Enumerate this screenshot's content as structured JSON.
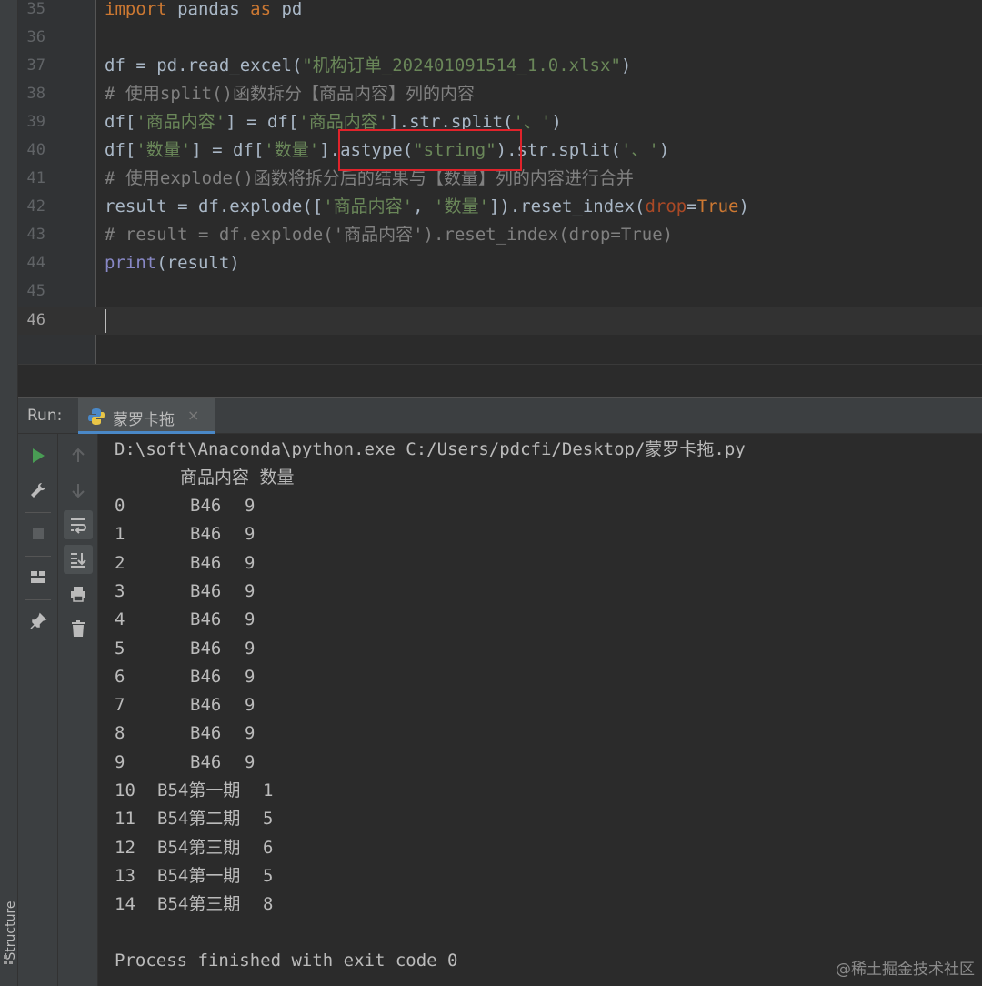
{
  "editor": {
    "lines": [
      {
        "num": "35"
      },
      {
        "num": "36"
      },
      {
        "num": "37"
      },
      {
        "num": "38"
      },
      {
        "num": "39"
      },
      {
        "num": "40"
      },
      {
        "num": "41"
      },
      {
        "num": "42"
      },
      {
        "num": "43"
      },
      {
        "num": "44"
      },
      {
        "num": "45"
      },
      {
        "num": "46"
      }
    ],
    "code": {
      "l35_kw1": "import",
      "l35_mod": " pandas ",
      "l35_kw2": "as",
      "l35_alias": " pd",
      "l37_a": "df = pd.read_excel(",
      "l37_str": "\"机构订单_202401091514_1.0.xlsx\"",
      "l37_b": ")",
      "l38_cmt": "# 使用split()函数拆分【商品内容】列的内容",
      "l39_a": "df[",
      "l39_s1": "'商品内容'",
      "l39_b": "] = df[",
      "l39_s2": "'商品内容'",
      "l39_c": "].str.split(",
      "l39_s3": "'、'",
      "l39_d": ")",
      "l40_a": "df[",
      "l40_s1": "'数量'",
      "l40_b": "] = df[",
      "l40_s2": "'数量'",
      "l40_c": "].astype(",
      "l40_s3": "\"string\"",
      "l40_d": ").str.split(",
      "l40_s4": "'、'",
      "l40_e": ")",
      "l41_cmt": "# 使用explode()函数将拆分后的结果与【数量】列的内容进行合并",
      "l42_a": "result = df.explode([",
      "l42_s1": "'商品内容'",
      "l42_b": ", ",
      "l42_s2": "'数量'",
      "l42_c": "]).reset_index(",
      "l42_param": "drop",
      "l42_d": "=",
      "l42_kw": "True",
      "l42_e": ")",
      "l43_cmt": "# result = df.explode('商品内容').reset_index(drop=True)",
      "l44_bi": "print",
      "l44_rest": "(result)"
    }
  },
  "run": {
    "label": "Run:",
    "tab_name": "蒙罗卡拖",
    "tab_close": "×",
    "command": "D:\\soft\\Anaconda\\python.exe C:/Users/pdcfi/Desktop/蒙罗卡拖.py",
    "header": "商品内容 数量",
    "rows": [
      {
        "idx": "0",
        "item": "B46",
        "qty": "9"
      },
      {
        "idx": "1",
        "item": "B46",
        "qty": "9"
      },
      {
        "idx": "2",
        "item": "B46",
        "qty": "9"
      },
      {
        "idx": "3",
        "item": "B46",
        "qty": "9"
      },
      {
        "idx": "4",
        "item": "B46",
        "qty": "9"
      },
      {
        "idx": "5",
        "item": "B46",
        "qty": "9"
      },
      {
        "idx": "6",
        "item": "B46",
        "qty": "9"
      },
      {
        "idx": "7",
        "item": "B46",
        "qty": "9"
      },
      {
        "idx": "8",
        "item": "B46",
        "qty": "9"
      },
      {
        "idx": "9",
        "item": "B46",
        "qty": "9"
      },
      {
        "idx": "10",
        "item": "B54第一期",
        "qty": "1"
      },
      {
        "idx": "11",
        "item": "B54第二期",
        "qty": "5"
      },
      {
        "idx": "12",
        "item": "B54第三期",
        "qty": "6"
      },
      {
        "idx": "13",
        "item": "B54第一期",
        "qty": "5"
      },
      {
        "idx": "14",
        "item": "B54第三期",
        "qty": "8"
      }
    ],
    "finished": "Process finished with exit code 0"
  },
  "sidebar": {
    "structure_label": "Structure"
  },
  "watermark": "@稀土掘金技术社区",
  "colors": {
    "keyword": "#cc7832",
    "string": "#6a8759",
    "comment": "#808080",
    "highlight": "#e0232b",
    "run_green": "#499c54"
  }
}
